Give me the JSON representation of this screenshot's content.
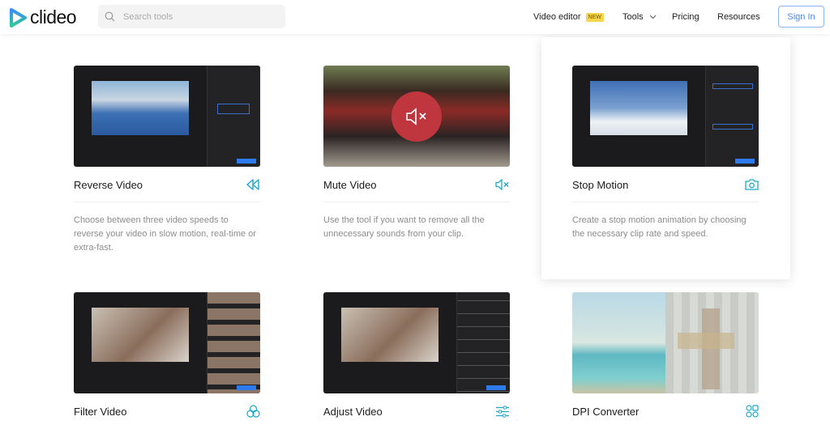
{
  "header": {
    "logo": "clideo",
    "search_placeholder": "Search tools",
    "nav": {
      "video_editor": "Video editor",
      "new_badge": "NEW",
      "tools": "Tools",
      "pricing": "Pricing",
      "resources": "Resources"
    },
    "sign_in": "Sign In"
  },
  "cards": [
    {
      "title": "Reverse Video",
      "icon": "rewind-icon",
      "desc": "Choose between three video speeds to reverse your video in slow motion, real-time or extra-fast."
    },
    {
      "title": "Mute Video",
      "icon": "mute-icon",
      "desc": "Use the tool if you want to remove all the unnecessary sounds from your clip."
    },
    {
      "title": "Stop Motion",
      "icon": "camera-icon",
      "desc": "Create a stop motion animation by choosing the necessary clip rate and speed."
    },
    {
      "title": "Filter Video",
      "icon": "filter-icon"
    },
    {
      "title": "Adjust Video",
      "icon": "sliders-icon"
    },
    {
      "title": "DPI Converter",
      "icon": "grid-icon"
    }
  ],
  "colors": {
    "accent": "#2e7bf0",
    "icon": "#1ca7c9",
    "mute_circle": "#c0363f",
    "badge": "#f9d54a"
  }
}
